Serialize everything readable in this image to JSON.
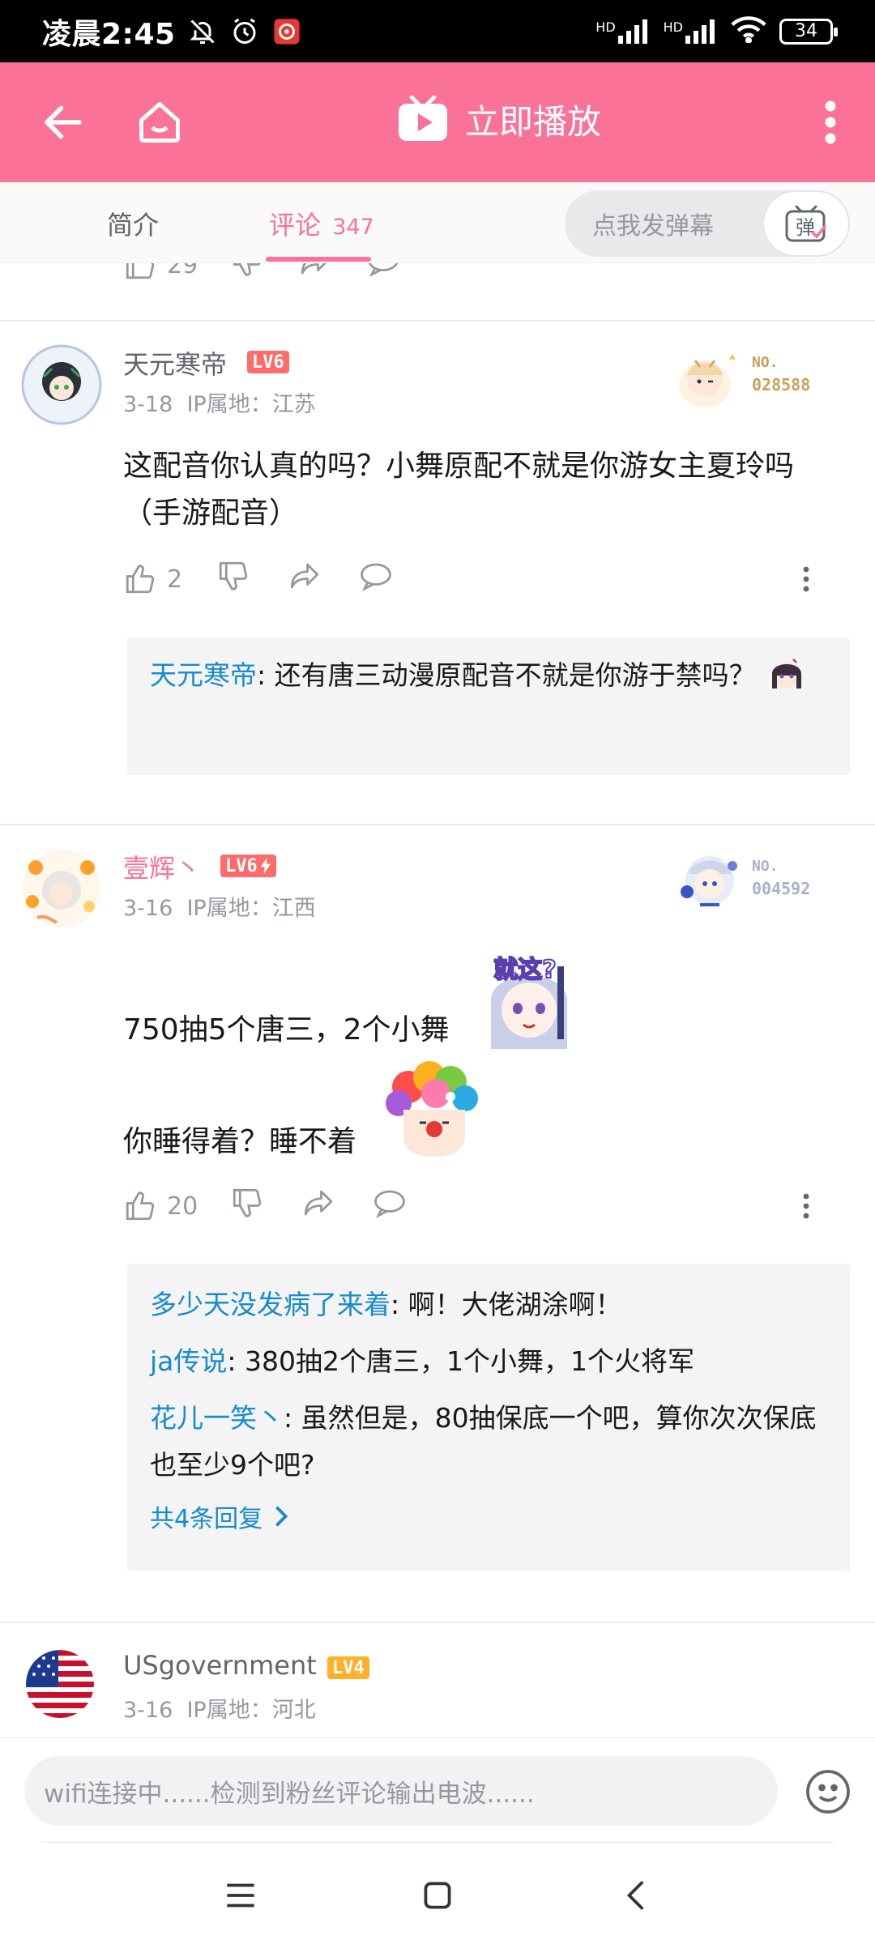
{
  "status": {
    "time": "凌晨2:45",
    "net1": "HD",
    "net2": "HD",
    "battery": "34"
  },
  "header": {
    "play_label": "立即播放"
  },
  "tabs": [
    {
      "label": "简介"
    },
    {
      "label": "评论",
      "count": "347"
    }
  ],
  "danmaku": {
    "placeholder": "点我发弹幕",
    "button_label": "弹"
  },
  "prev_comment": {
    "likes": "29"
  },
  "comments": [
    {
      "user": "天元寒帝",
      "level": "LV6",
      "date": "3-18",
      "ip": "IP属地：江苏",
      "fan_badge_no": "NO.",
      "fan_badge_num": "028588",
      "text": "这配音你认真的吗？小舞原配不就是你游女主夏玲吗（手游配音）",
      "likes": "2",
      "replies": [
        {
          "name": "天元寒帝",
          "text": ": 还有唐三动漫原配音不就是你游于禁吗？"
        }
      ]
    },
    {
      "user": "壹辉丶",
      "level": "LV6",
      "date": "3-16",
      "ip": "IP属地：江西",
      "fan_badge_no": "NO.",
      "fan_badge_num": "004592",
      "line1": "750抽5个唐三，2个小舞",
      "sticker1_text": "就这?",
      "line2": "你睡得着？睡不着",
      "likes": "20",
      "replies": [
        {
          "name": "多少天没发病了来着",
          "text": ": 啊！大佬湖涂啊！"
        },
        {
          "name": "ja传说",
          "text": ": 380抽2个唐三，1个小舞，1个火将军"
        },
        {
          "name": "花儿一笑丶",
          "text": ": 虽然但是，80抽保底一个吧，算你次次保底也至少9个吧?"
        }
      ],
      "more_replies": "共4条回复"
    },
    {
      "user": "USgovernment",
      "level": "LV4",
      "date": "3-16",
      "ip": "IP属地：河北"
    }
  ],
  "input": {
    "placeholder": "wifi连接中......检测到粉丝评论输出电波......"
  },
  "colors": {
    "brand_pink": "#fb7299",
    "reply_blue": "#178bcf",
    "lv6": "#ff6b6b",
    "lv4": "#ffb027"
  }
}
